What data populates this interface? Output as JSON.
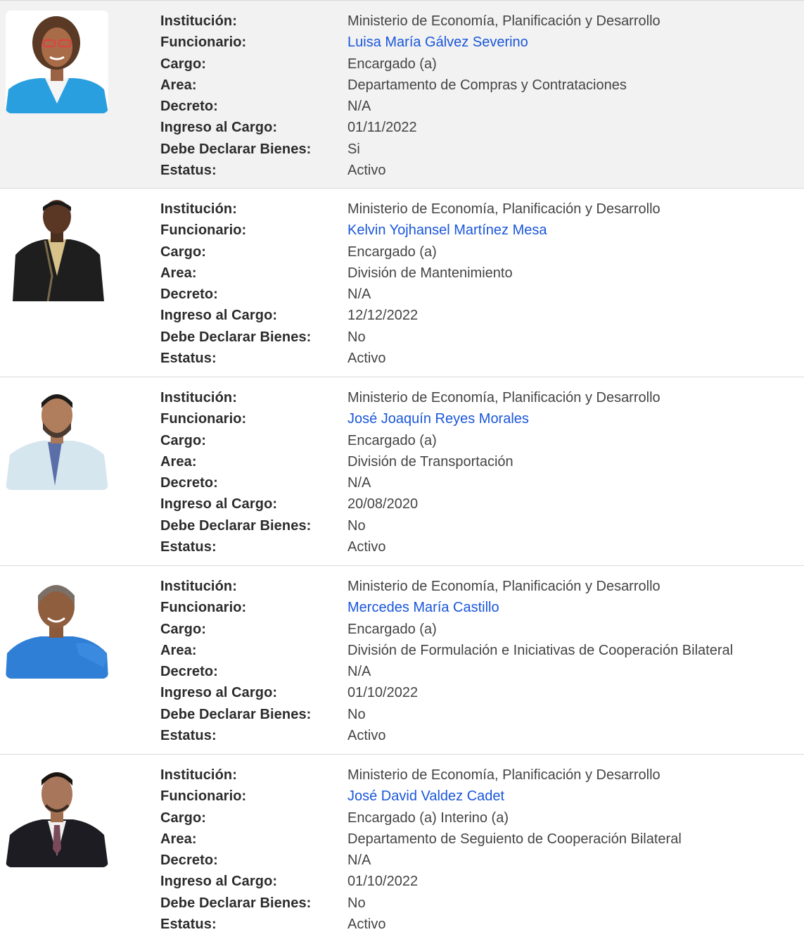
{
  "labels": {
    "institucion": "Institución:",
    "funcionario": "Funcionario:",
    "cargo": "Cargo:",
    "area": "Area:",
    "decreto": "Decreto:",
    "ingreso": "Ingreso al Cargo:",
    "declarar": "Debe Declarar Bienes:",
    "estatus": "Estatus:"
  },
  "colors": {
    "link": "#1a56db",
    "highlight_row": "#f2f2f2"
  },
  "entries": [
    {
      "institucion": "Ministerio de Economía, Planificación y Desarrollo",
      "funcionario": "Luisa María Gálvez Severino",
      "cargo": "Encargado (a)",
      "area": "Departamento de Compras y Contrataciones",
      "decreto": "N/A",
      "ingreso": "01/11/2022",
      "declarar": "Si",
      "estatus": "Activo"
    },
    {
      "institucion": "Ministerio de Economía, Planificación y Desarrollo",
      "funcionario": "Kelvin Yojhansel Martínez Mesa",
      "cargo": "Encargado (a)",
      "area": "División de Mantenimiento",
      "decreto": "N/A",
      "ingreso": "12/12/2022",
      "declarar": "No",
      "estatus": "Activo"
    },
    {
      "institucion": "Ministerio de Economía, Planificación y Desarrollo",
      "funcionario": "José Joaquín Reyes Morales",
      "cargo": "Encargado (a)",
      "area": "División de Transportación",
      "decreto": "N/A",
      "ingreso": "20/08/2020",
      "declarar": "No",
      "estatus": "Activo"
    },
    {
      "institucion": "Ministerio de Economía, Planificación y Desarrollo",
      "funcionario": "Mercedes María Castillo",
      "cargo": "Encargado (a)",
      "area": "División de Formulación e Iniciativas de Cooperación Bilateral",
      "decreto": "N/A",
      "ingreso": "01/10/2022",
      "declarar": "No",
      "estatus": "Activo"
    },
    {
      "institucion": "Ministerio de Economía, Planificación y Desarrollo",
      "funcionario": "José David Valdez Cadet",
      "cargo": "Encargado (a) Interino (a)",
      "area": "Departamento de Seguiento de Cooperación Bilateral",
      "decreto": "N/A",
      "ingreso": "01/10/2022",
      "declarar": "No",
      "estatus": "Activo"
    }
  ]
}
